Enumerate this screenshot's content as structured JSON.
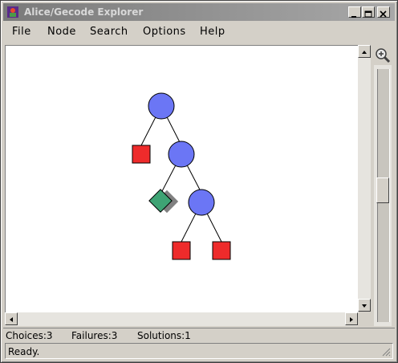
{
  "window": {
    "title": "Alice/Gecode Explorer"
  },
  "menu": {
    "items": [
      {
        "label": "File"
      },
      {
        "label": "Node"
      },
      {
        "label": "Search"
      },
      {
        "label": "Options"
      },
      {
        "label": "Help"
      }
    ]
  },
  "tree": {
    "nodes": [
      {
        "id": "root",
        "kind": "choice"
      },
      {
        "id": "fail-1",
        "kind": "failure"
      },
      {
        "id": "choice-2",
        "kind": "choice"
      },
      {
        "id": "solution-1",
        "kind": "solution"
      },
      {
        "id": "choice-3",
        "kind": "choice"
      },
      {
        "id": "fail-2",
        "kind": "failure"
      },
      {
        "id": "fail-3",
        "kind": "failure"
      }
    ],
    "colors": {
      "choice": "#6b76f5",
      "failure": "#ee2b2b",
      "solution": "#3ea374",
      "shadow": "#808080"
    }
  },
  "status": {
    "choices": "Choices:3",
    "failures": "Failures:3",
    "solutions": "Solutions:1",
    "message": "Ready."
  }
}
